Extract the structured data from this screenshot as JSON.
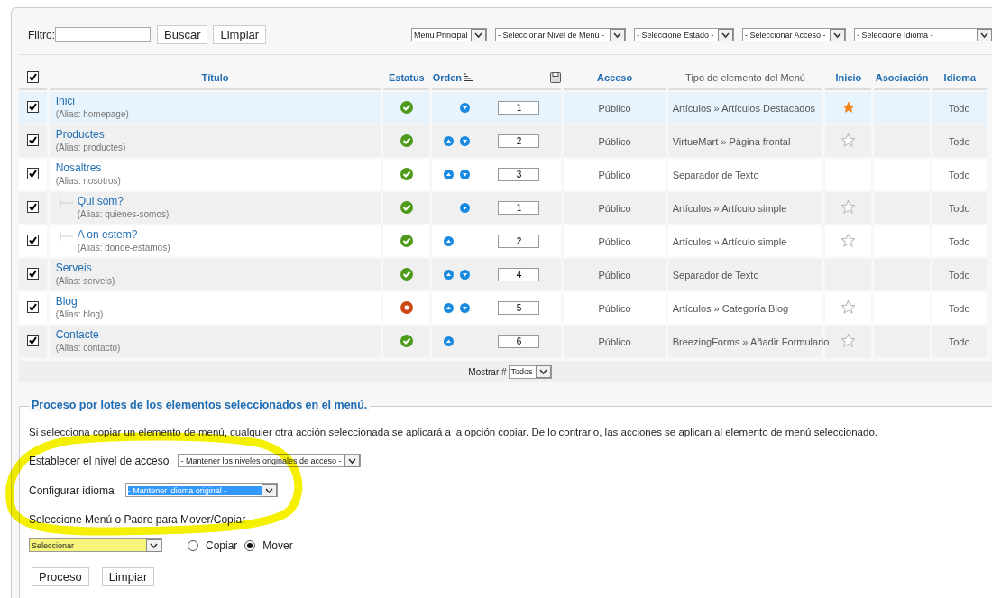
{
  "filter": {
    "label": "Filtro:",
    "search_button": "Buscar",
    "clear_button": "Limpiar",
    "selects": [
      "Menu Principal",
      "- Seleccionar Nivel de Menú -",
      "- Seleccione Estado -",
      "- Seleccionar Acceso -",
      "- Seleccione Idioma -"
    ]
  },
  "table": {
    "select_all_checked": true,
    "columns": [
      {
        "label": "Título",
        "link": true
      },
      {
        "label": "Estatus",
        "link": true
      },
      {
        "label": "Orden",
        "link": true
      },
      {
        "label": "Acceso",
        "link": true
      },
      {
        "label": "Tipo de elemento del Menú",
        "link": false
      },
      {
        "label": "Inicio",
        "link": true
      },
      {
        "label": "Asociación",
        "link": true
      },
      {
        "label": "Idioma",
        "link": true
      }
    ],
    "rows": [
      {
        "title": "Inici",
        "alias": "(Alias: homepage)",
        "selected": true,
        "checked": true,
        "published": true,
        "move_up": false,
        "move_down": true,
        "order": "1",
        "access": "Público",
        "type": "Artículos » Artículos Destacados",
        "home": true,
        "language": "Todo"
      },
      {
        "title": "Productes",
        "alias": "(Alias: productes)",
        "selected": false,
        "checked": true,
        "published": true,
        "move_up": true,
        "move_down": true,
        "order": "2",
        "access": "Público",
        "type": "VirtueMart » Página frontal",
        "home": false,
        "language": "Todo"
      },
      {
        "title": "Nosaltres",
        "alias": "(Alias: nosotros)",
        "selected": false,
        "checked": true,
        "published": true,
        "move_up": true,
        "move_down": true,
        "order": "3",
        "access": "Público",
        "type": "Separador de Texto",
        "language": "Todo",
        "children": [
          {
            "title": "Qui som?",
            "alias": "(Alias: quienes-somos)",
            "selected": false,
            "checked": true,
            "published": true,
            "move_up": false,
            "move_down": true,
            "order": "1",
            "access": "Público",
            "type": "Artículos » Artículo simple",
            "home": false,
            "language": "Todo"
          },
          {
            "title": "A on estem?",
            "alias": "(Alias: donde-estamos)",
            "selected": false,
            "checked": true,
            "published": true,
            "move_up": true,
            "move_down": false,
            "order": "2",
            "access": "Público",
            "type": "Artículos » Artículo simple",
            "home": false,
            "language": "Todo"
          }
        ]
      },
      {
        "title": "Serveis",
        "alias": "(Alias: serveis)",
        "selected": false,
        "checked": true,
        "published": true,
        "move_up": true,
        "move_down": true,
        "order": "4",
        "access": "Público",
        "type": "Separador de Texto",
        "language": "Todo"
      },
      {
        "title": "Blog",
        "alias": "(Alias: blog)",
        "selected": false,
        "checked": true,
        "published": false,
        "move_up": true,
        "move_down": true,
        "order": "5",
        "access": "Público",
        "type": "Artículos » Categoría Blog",
        "home": false,
        "language": "Todo"
      },
      {
        "title": "Contacte",
        "alias": "(Alias: contacto)",
        "selected": false,
        "checked": true,
        "published": true,
        "move_up": true,
        "move_down": false,
        "order": "6",
        "access": "Público",
        "type": "BreezingForms » Añadir Formulario",
        "home": false,
        "language": "Todo"
      }
    ]
  },
  "pagination": {
    "label": "Mostrar #",
    "value": "Todos"
  },
  "batch": {
    "legend": "Proceso por lotes de los elementos seleccionados en el menú.",
    "description": "Si selecciona copiar un elemento de menú, cualquier otra acción seleccionada se aplicará a la opción copiar. De lo contrario, las acciones se aplican al elemento de menú seleccionado.",
    "access_label": "Establecer el nivel de acceso",
    "access_value": "- Mantener los niveles originales de acceso -",
    "language_label": "Configurar idioma",
    "language_value": "- Mantener idioma original -",
    "menu_label": "Seleccione Menú o Padre para Mover/Copiar",
    "menu_value": "Seleccionar",
    "options": [
      {
        "label": "Copiar",
        "selected": false
      },
      {
        "label": "Mover",
        "selected": true
      }
    ],
    "buttons": [
      "Proceso",
      "Limpiar"
    ]
  }
}
